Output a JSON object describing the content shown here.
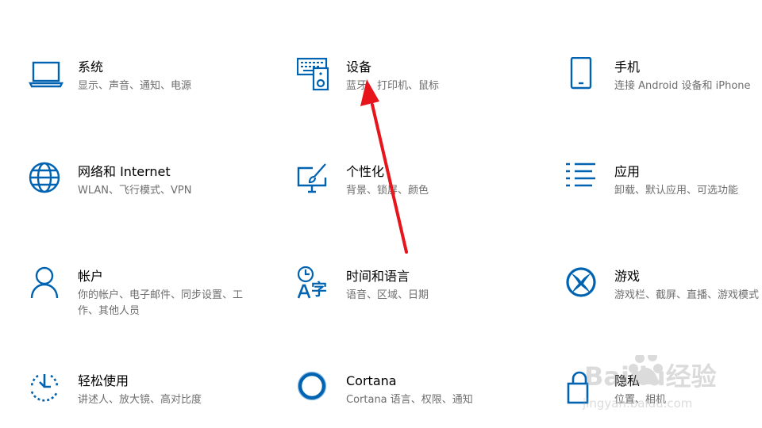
{
  "colors": {
    "accent": "#0063b1",
    "arrow": "#e8141c",
    "desc": "#6e6e6e"
  },
  "tiles": [
    {
      "title": "系统",
      "desc": "显示、声音、通知、电源",
      "icon": "laptop-icon"
    },
    {
      "title": "设备",
      "desc": "蓝牙、打印机、鼠标",
      "icon": "keyboard-speaker-icon"
    },
    {
      "title": "手机",
      "desc": "连接 Android 设备和 iPhone",
      "icon": "phone-icon"
    },
    {
      "title": "网络和 Internet",
      "desc": "WLAN、飞行模式、VPN",
      "icon": "globe-icon"
    },
    {
      "title": "个性化",
      "desc": "背景、锁屏、颜色",
      "icon": "paint-monitor-icon"
    },
    {
      "title": "应用",
      "desc": "卸载、默认应用、可选功能",
      "icon": "apps-list-icon"
    },
    {
      "title": "帐户",
      "desc": "你的帐户、电子邮件、同步设置、工作、其他人员",
      "icon": "person-icon"
    },
    {
      "title": "时间和语言",
      "desc": "语音、区域、日期",
      "icon": "time-language-icon"
    },
    {
      "title": "游戏",
      "desc": "游戏栏、截屏、直播、游戏模式",
      "icon": "xbox-icon"
    },
    {
      "title": "轻松使用",
      "desc": "讲述人、放大镜、高对比度",
      "icon": "ease-of-access-icon"
    },
    {
      "title": "Cortana",
      "desc": "Cortana 语言、权限、通知",
      "icon": "cortana-icon"
    },
    {
      "title": "隐私",
      "desc": "位置、相机",
      "icon": "lock-icon"
    }
  ],
  "watermark": {
    "text": "Baidu经验",
    "url": "jingyan.baidu.com"
  }
}
